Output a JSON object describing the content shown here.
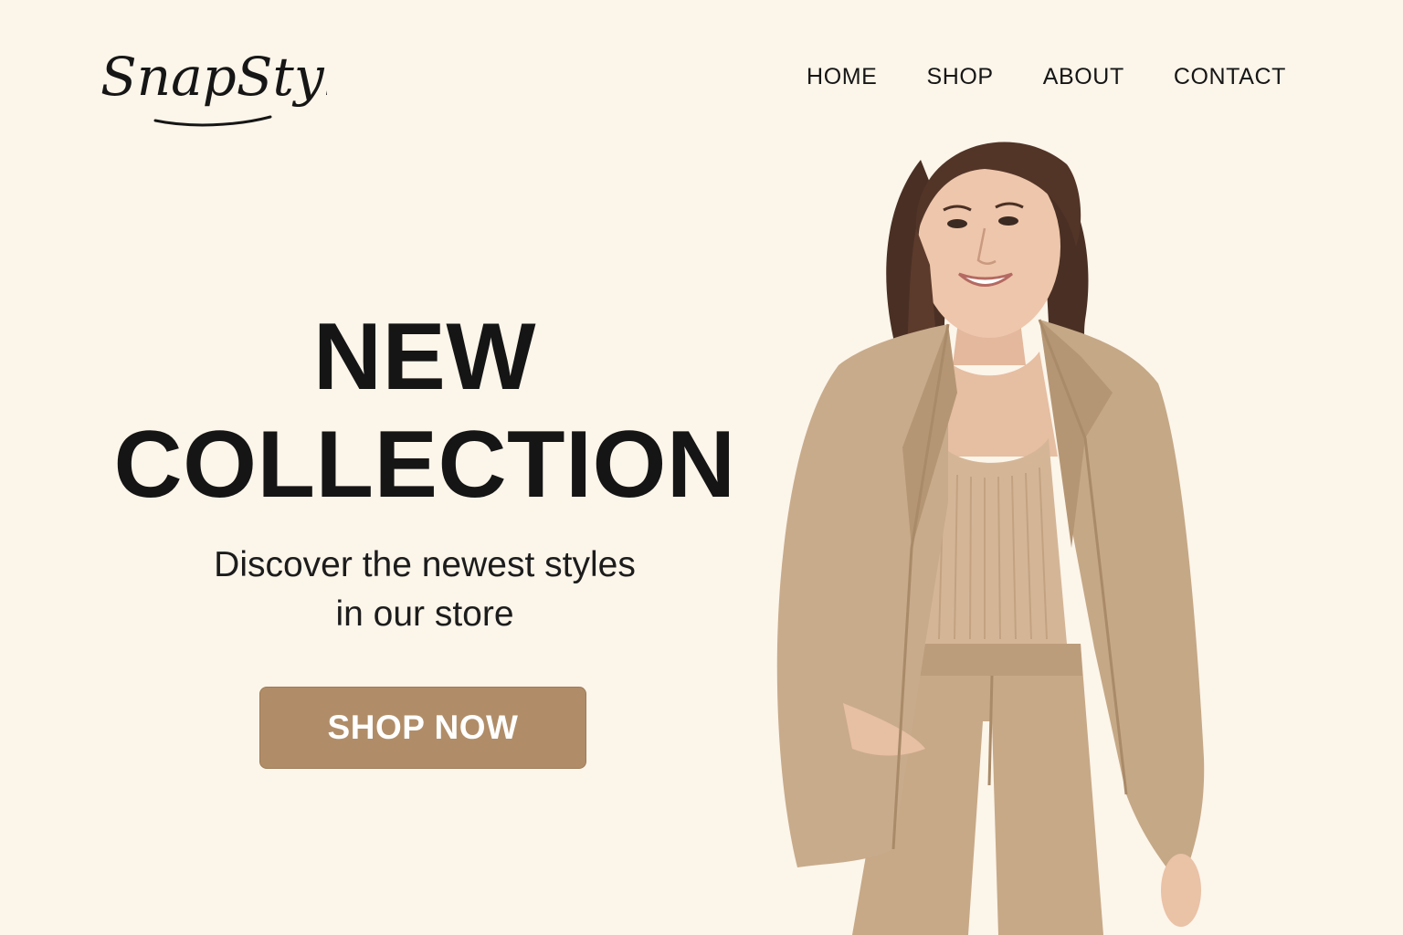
{
  "brand": {
    "logo_text": "SnapStyle"
  },
  "nav": {
    "items": [
      {
        "label": "HOME"
      },
      {
        "label": "SHOP"
      },
      {
        "label": "ABOUT"
      },
      {
        "label": "CONTACT"
      }
    ]
  },
  "hero": {
    "title_lines": [
      "NEW",
      "COLLECTION"
    ],
    "subtitle_lines": [
      "Discover the newest styles",
      "in our store"
    ],
    "cta_label": "SHOP NOW"
  },
  "colors": {
    "background": "#fcf5ea",
    "text": "#151515",
    "cta": "#b08d68",
    "suit": "#c7ab8c"
  },
  "icons": {
    "logo": "snapstyle-script-logo",
    "hero_image": "model-in-beige-suit"
  }
}
